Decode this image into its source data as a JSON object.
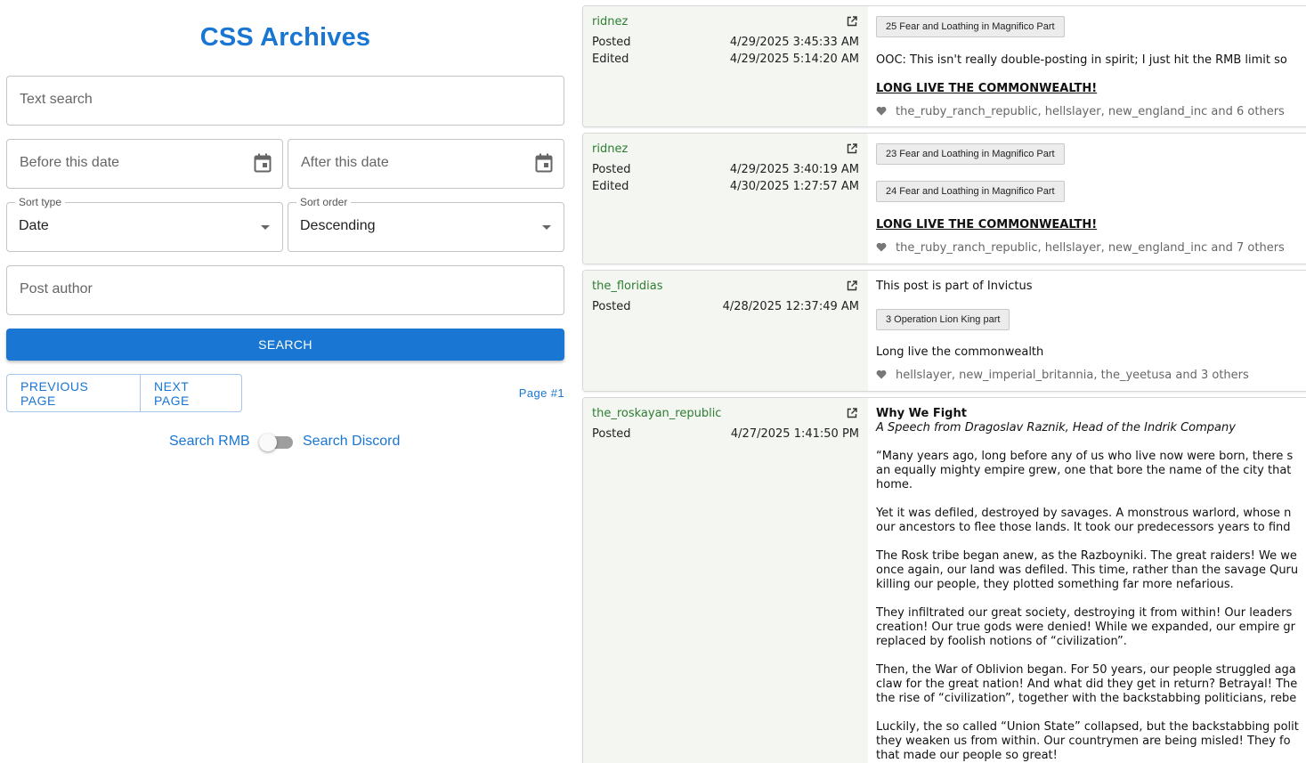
{
  "app": {
    "title": "CSS Archives"
  },
  "search": {
    "text_placeholder": "Text search",
    "before_placeholder": "Before this date",
    "after_placeholder": "After this date",
    "sort_type_label": "Sort type",
    "sort_type_value": "Date",
    "sort_order_label": "Sort order",
    "sort_order_value": "Descending",
    "author_placeholder": "Post author",
    "search_button": "SEARCH",
    "prev_button": "PREVIOUS PAGE",
    "next_button": "NEXT PAGE",
    "page_label": "Page #1",
    "toggle_left": "Search RMB",
    "toggle_right": "Search Discord"
  },
  "posts": [
    {
      "author": "ridnez",
      "posted_label": "Posted",
      "posted": "4/29/2025 3:45:33 AM",
      "edited_label": "Edited",
      "edited": "4/29/2025 5:14:20 AM",
      "chips": [
        "25 Fear and Loathing in Magnifico Part"
      ],
      "text": "OOC: This isn't really double-posting in spirit; I just hit the RMB limit so",
      "bold": "LONG LIVE THE COMMONWEALTH!",
      "likes": "the_ruby_ranch_republic, hellslayer, new_england_inc and 6 others"
    },
    {
      "author": "ridnez",
      "posted_label": "Posted",
      "posted": "4/29/2025 3:40:19 AM",
      "edited_label": "Edited",
      "edited": "4/30/2025 1:27:57 AM",
      "chips": [
        "23 Fear and Loathing in Magnifico Part",
        "24 Fear and Loathing in Magnifico Part"
      ],
      "bold": "LONG LIVE THE COMMONWEALTH!",
      "likes": "the_ruby_ranch_republic, hellslayer, new_england_inc and 7 others"
    },
    {
      "author": "the_floridias",
      "posted_label": "Posted",
      "posted": "4/28/2025 12:37:49 AM",
      "intro": "This post is part of Invictus",
      "chips": [
        "3 Operation Lion King part"
      ],
      "text": "Long live the commonwealth",
      "likes": "hellslayer, new_imperial_britannia, the_yeetusa and 3 others"
    },
    {
      "author": "the_roskayan_republic",
      "posted_label": "Posted",
      "posted": "4/27/2025 1:41:50 PM",
      "heading": "Why We Fight",
      "subheading": "A Speech from Dragoslav Raznik, Head of the Indrik Company",
      "paragraphs": [
        [
          "“Many years ago, long before any of us who live now were born, there s",
          "an equally mighty empire grew, one that bore the name of the city that",
          "home."
        ],
        [
          "Yet it was defiled, destroyed by savages. A monstrous warlord, whose n",
          "our ancestors to flee those lands. It took our predecessors years to find"
        ],
        [
          "The Rosk tribe began anew, as the Razboyniki. The great raiders! We we",
          "once again, our land was defiled. This time, rather than the savage Quru",
          "killing our people, they plotted something far more nefarious."
        ],
        [
          "They infiltrated our great society, destroying it from within! Our leaders",
          "creation! Our true gods were denied! While we expanded, our empire gr",
          "replaced by foolish notions of “civilization”."
        ],
        [
          "Then, the War of Oblivion began. For 50 years, our people struggled aga",
          "claw for the great nation! And what did they get in return? Betrayal! The",
          "the rise of “civilization”, together with the backstabbing politicians, rebe"
        ],
        [
          "Luckily, the so called “Union State” collapsed, but the backstabbing polit",
          "they weaken us from within. Our countrymen are being misled! They fo",
          "that made our people so great!"
        ]
      ]
    }
  ]
}
